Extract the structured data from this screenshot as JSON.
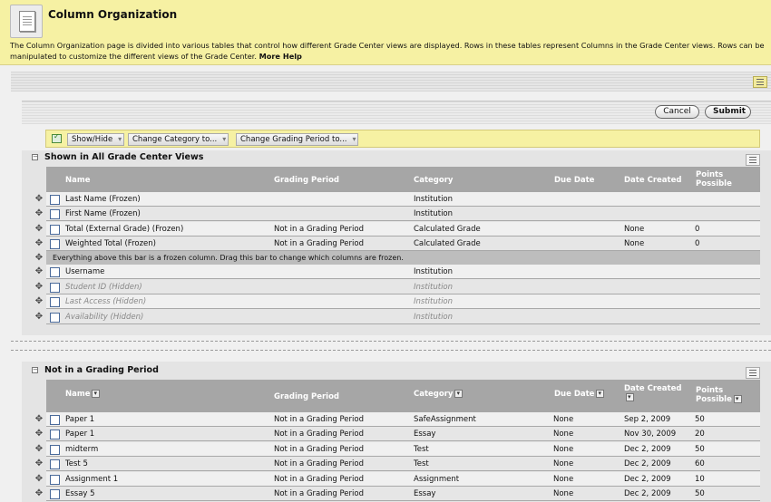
{
  "header": {
    "title": "Column Organization",
    "description": "The Column Organization page is divided into various tables that control how different Grade Center views are displayed. Rows in these tables represent Columns in the Grade Center views. Rows can be manipulated to customize the different views of the Grade Center.",
    "more_help": "More Help"
  },
  "buttons": {
    "cancel": "Cancel",
    "submit": "Submit"
  },
  "action_bar": {
    "show_hide": "Show/Hide",
    "change_category": "Change Category to...",
    "change_grading_period": "Change Grading Period to..."
  },
  "section1": {
    "title": "Shown in All Grade Center Views",
    "columns": {
      "name": "Name",
      "grading_period": "Grading Period",
      "category": "Category",
      "due_date": "Due Date",
      "date_created": "Date Created",
      "points_possible": "Points Possible"
    },
    "rows": [
      {
        "name": "Last Name (Frozen)",
        "grading_period": "",
        "category": "Institution",
        "due_date": "",
        "date_created": "",
        "points": ""
      },
      {
        "name": "First Name (Frozen)",
        "grading_period": "",
        "category": "Institution",
        "due_date": "",
        "date_created": "",
        "points": ""
      },
      {
        "name": "Total (External Grade) (Frozen)",
        "grading_period": "Not in a Grading Period",
        "category": "Calculated Grade",
        "due_date": "",
        "date_created": "None",
        "points": "0"
      },
      {
        "name": "Weighted Total (Frozen)",
        "grading_period": "Not in a Grading Period",
        "category": "Calculated Grade",
        "due_date": "",
        "date_created": "None",
        "points": "0"
      }
    ],
    "frozen_bar": "Everything above this bar is a frozen column. Drag this bar to change which columns are frozen.",
    "rows_after": [
      {
        "name": "Username",
        "category": "Institution"
      },
      {
        "name": "Student ID (Hidden)",
        "category": "Institution"
      },
      {
        "name": "Last Access (Hidden)",
        "category": "Institution"
      },
      {
        "name": "Availability (Hidden)",
        "category": "Institution"
      }
    ]
  },
  "section2": {
    "title": "Not in a Grading Period",
    "columns": {
      "name": "Name",
      "grading_period": "Grading Period",
      "category": "Category",
      "due_date": "Due Date",
      "date_created": "Date Created",
      "points_possible": "Points Possible"
    },
    "rows": [
      {
        "name": "Paper 1",
        "grading_period": "Not in a Grading Period",
        "category": "SafeAssignment",
        "due_date": "None",
        "date_created": "Sep 2, 2009",
        "points": "50"
      },
      {
        "name": "Paper 1",
        "grading_period": "Not in a Grading Period",
        "category": "Essay",
        "due_date": "None",
        "date_created": "Nov 30, 2009",
        "points": "20"
      },
      {
        "name": "midterm",
        "grading_period": "Not in a Grading Period",
        "category": "Test",
        "due_date": "None",
        "date_created": "Dec 2, 2009",
        "points": "50"
      },
      {
        "name": "Test 5",
        "grading_period": "Not in a Grading Period",
        "category": "Test",
        "due_date": "None",
        "date_created": "Dec 2, 2009",
        "points": "60"
      },
      {
        "name": "Assignment 1",
        "grading_period": "Not in a Grading Period",
        "category": "Assignment",
        "due_date": "None",
        "date_created": "Dec 2, 2009",
        "points": "10"
      },
      {
        "name": "Essay 5",
        "grading_period": "Not in a Grading Period",
        "category": "Essay",
        "due_date": "None",
        "date_created": "Dec 2, 2009",
        "points": "50"
      }
    ]
  }
}
